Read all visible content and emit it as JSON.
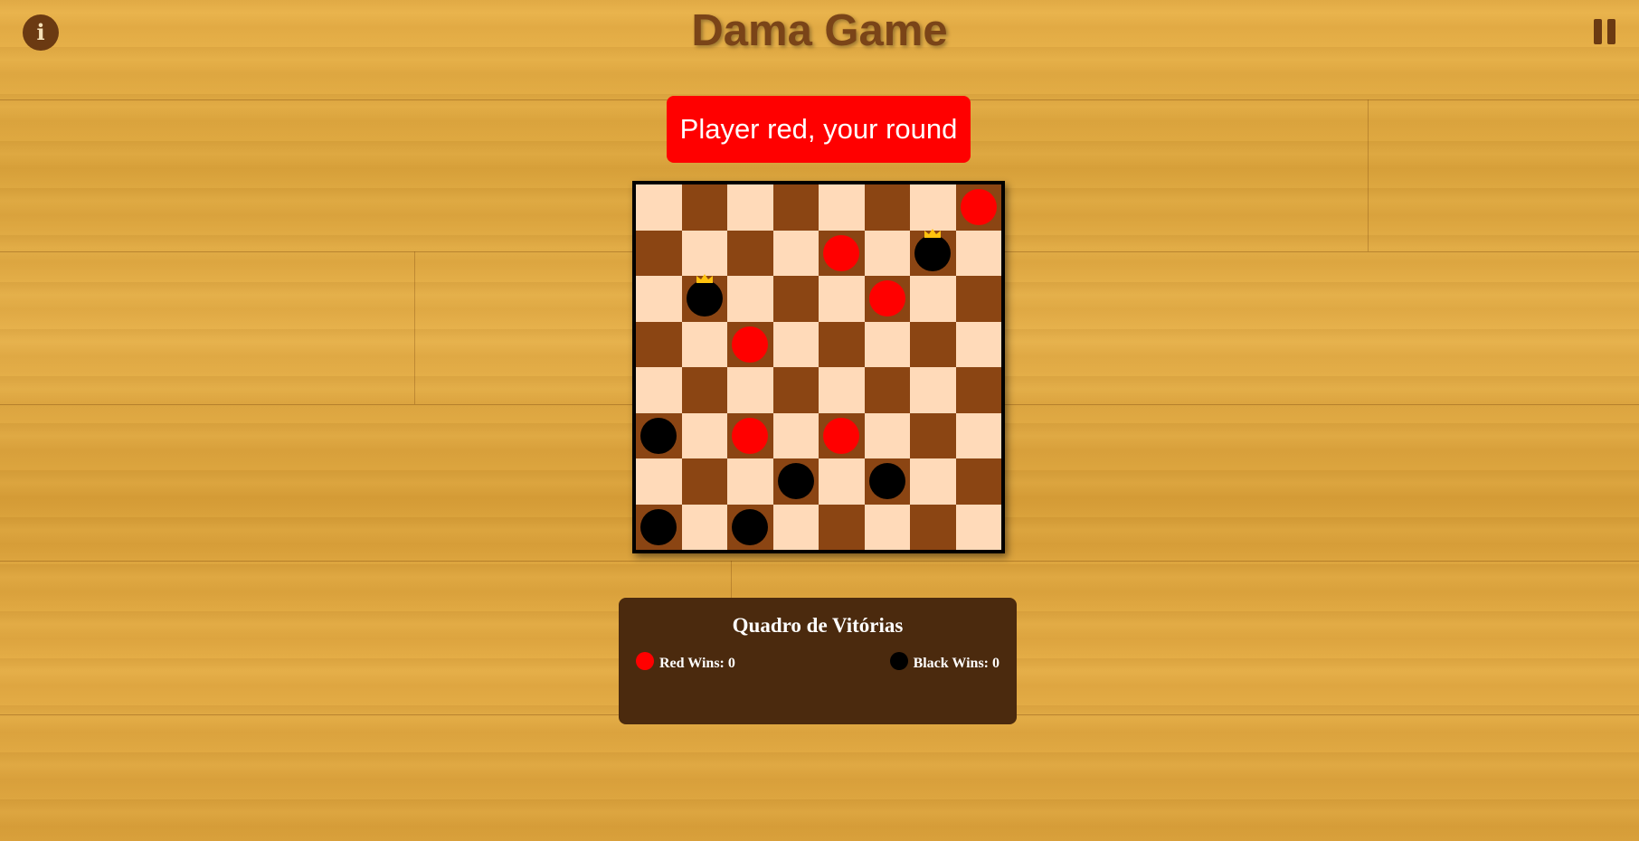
{
  "header": {
    "title": "Dama Game"
  },
  "controls": {
    "info_icon": "info-icon",
    "info_glyph": "i",
    "pause_icon": "pause-icon"
  },
  "status": {
    "text": "Player red, your round",
    "color": "#ff0000"
  },
  "board": {
    "size": 8,
    "light_color": "#ffdab9",
    "dark_color": "#8b4513",
    "pieces": [
      {
        "row": 0,
        "col": 7,
        "color": "red",
        "king": false
      },
      {
        "row": 1,
        "col": 4,
        "color": "red",
        "king": false
      },
      {
        "row": 1,
        "col": 6,
        "color": "black",
        "king": true
      },
      {
        "row": 2,
        "col": 1,
        "color": "black",
        "king": true
      },
      {
        "row": 2,
        "col": 5,
        "color": "red",
        "king": false
      },
      {
        "row": 3,
        "col": 2,
        "color": "red",
        "king": false
      },
      {
        "row": 5,
        "col": 0,
        "color": "black",
        "king": false
      },
      {
        "row": 5,
        "col": 2,
        "color": "red",
        "king": false
      },
      {
        "row": 5,
        "col": 4,
        "color": "red",
        "king": false
      },
      {
        "row": 6,
        "col": 3,
        "color": "black",
        "king": false
      },
      {
        "row": 6,
        "col": 5,
        "color": "black",
        "king": false
      },
      {
        "row": 7,
        "col": 0,
        "color": "black",
        "king": false
      },
      {
        "row": 7,
        "col": 2,
        "color": "black",
        "king": false
      }
    ]
  },
  "scoreboard": {
    "title": "Quadro de Vitórias",
    "red_label": "Red Wins: 0",
    "black_label": "Black Wins: 0"
  }
}
